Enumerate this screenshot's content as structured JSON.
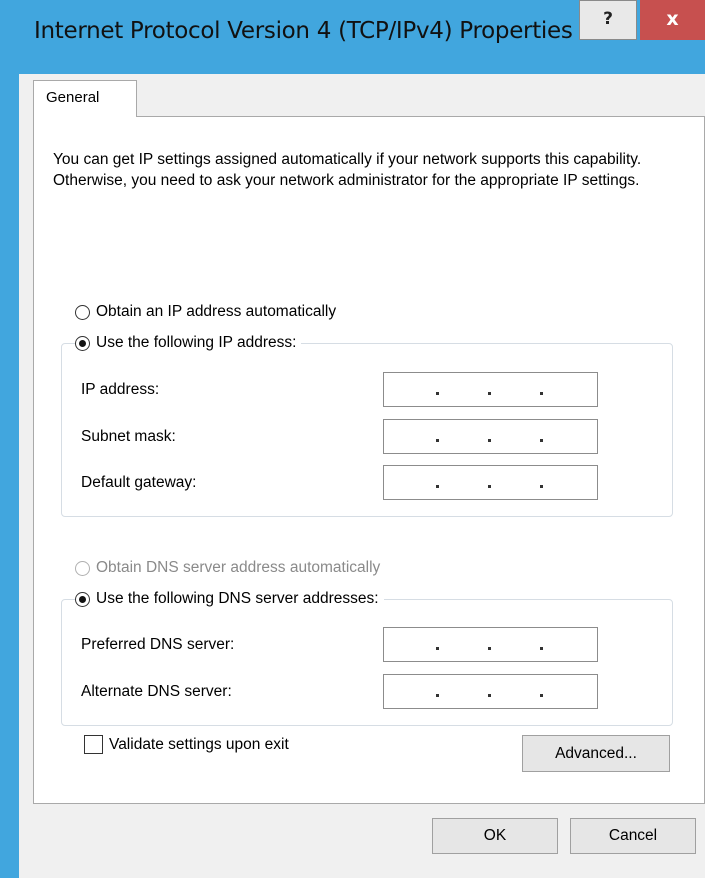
{
  "window": {
    "title": "Internet Protocol Version 4 (TCP/IPv4) Properties",
    "help_label": "?",
    "close_label": "x"
  },
  "tabs": [
    {
      "label": "General",
      "selected": true
    }
  ],
  "general": {
    "intro": "You can get IP settings assigned automatically if your network supports this capability. Otherwise, you need to ask your network administrator for the appropriate IP settings.",
    "ip_auto": {
      "label": "Obtain an IP address automatically",
      "checked": false
    },
    "ip_manual": {
      "label": "Use the following IP address:",
      "checked": true
    },
    "ip_fields": [
      {
        "label": "IP address:",
        "value": ""
      },
      {
        "label": "Subnet mask:",
        "value": ""
      },
      {
        "label": "Default gateway:",
        "value": ""
      }
    ],
    "dns_auto": {
      "label": "Obtain DNS server address automatically",
      "checked": false,
      "enabled": false
    },
    "dns_manual": {
      "label": "Use the following DNS server addresses:",
      "checked": true
    },
    "dns_fields": [
      {
        "label": "Preferred DNS server:",
        "value": ""
      },
      {
        "label": "Alternate DNS server:",
        "value": ""
      }
    ],
    "validate": {
      "label": "Validate settings upon exit",
      "checked": false
    },
    "advanced_label": "Advanced..."
  },
  "footer": {
    "ok_label": "OK",
    "cancel_label": "Cancel"
  },
  "colors": {
    "titlebar": "#41a6de",
    "close_button": "#c7504f",
    "dialog_background": "#f0f0f0",
    "disabled_text": "#8a8a8a"
  }
}
